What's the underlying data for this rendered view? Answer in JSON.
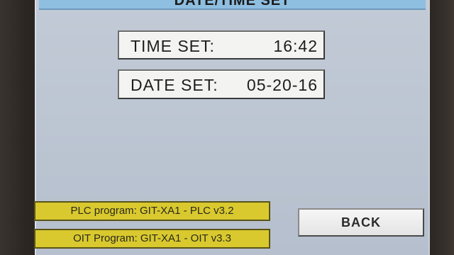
{
  "screen": {
    "title": "DATE/TIME SET"
  },
  "time_set": {
    "label": "TIME SET:",
    "value": "16:42"
  },
  "date_set": {
    "label": "DATE SET:",
    "value": "05-20-16"
  },
  "info": {
    "plc_program": "PLC program: GIT-XA1 - PLC v3.2",
    "oit_program": "OIT Program: GIT-XA1 - OIT v3.3"
  },
  "buttons": {
    "back_label": "BACK"
  },
  "colors": {
    "screen_background": "#bcc5d2",
    "title_bar": "#8fbfe0",
    "info_box": "#d9c92f",
    "field_background": "#f3f3f1",
    "button_background": "#eeeeee"
  }
}
